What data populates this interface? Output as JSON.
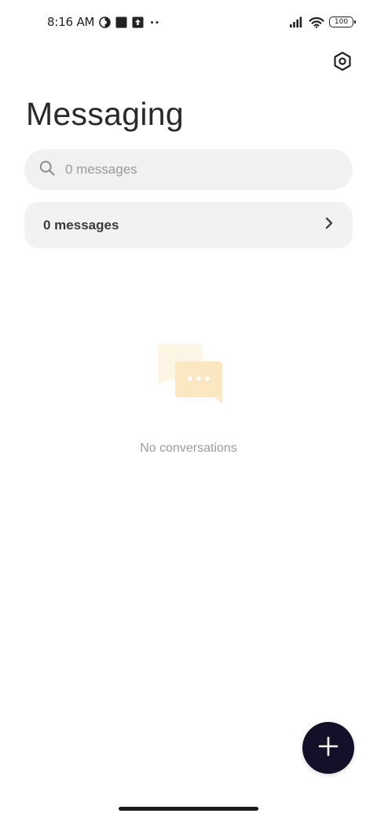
{
  "status_bar": {
    "time": "8:16 AM",
    "left_icons": [
      "data-saver-icon",
      "square-notification-icon",
      "upload-notification-icon",
      "more-notifications-icon"
    ],
    "right_icons": [
      "cell-signal-icon",
      "wifi-icon",
      "battery-icon"
    ],
    "battery_level": "100"
  },
  "header": {
    "title": "Messaging",
    "settings_icon": "settings-icon"
  },
  "search": {
    "placeholder": "0 messages",
    "icon": "search-icon"
  },
  "messages_row": {
    "label": "0 messages",
    "icon": "chevron-right-icon"
  },
  "empty_state": {
    "icon": "chat-bubbles-icon",
    "text": "No conversations"
  },
  "fab": {
    "icon": "plus-icon",
    "color": "#141029"
  }
}
